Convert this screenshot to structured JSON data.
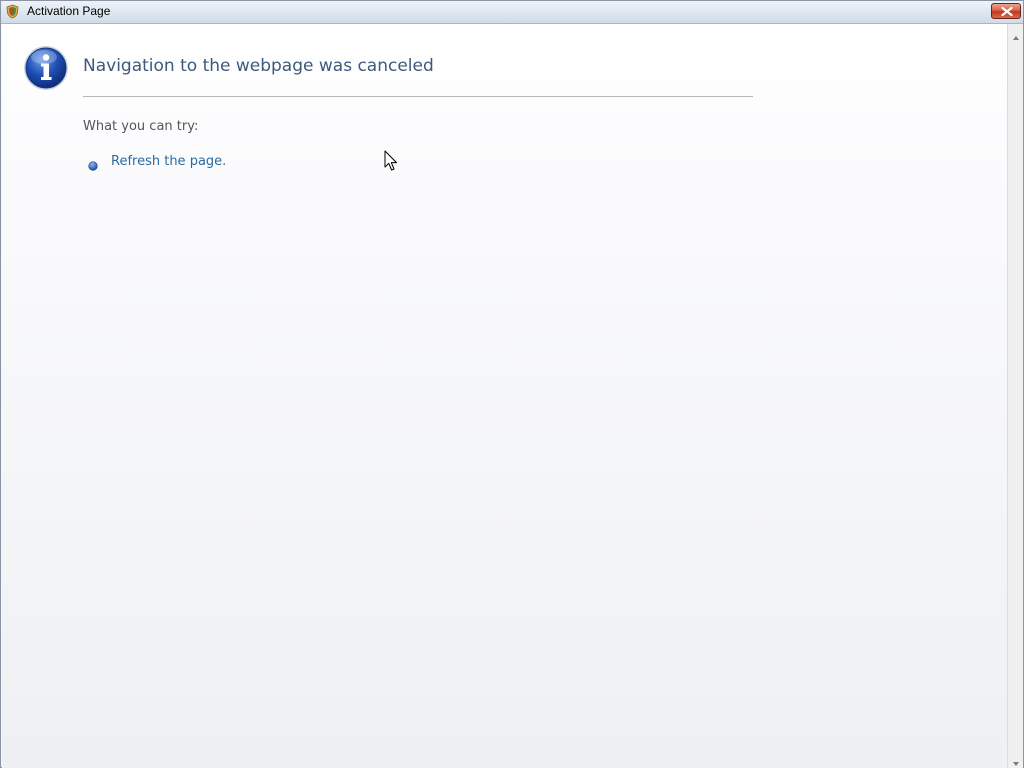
{
  "window": {
    "title": "Activation Page"
  },
  "page": {
    "heading": "Navigation to the webpage was canceled",
    "try_label": "What you can try:",
    "suggestions": [
      {
        "label": "Refresh the page.",
        "icon": "bullet-icon"
      }
    ]
  },
  "icons": {
    "app": "shield-icon",
    "info": "info-icon",
    "close": "close-icon",
    "cursor": "mouse-pointer-icon"
  },
  "colors": {
    "heading": "#3c5a7d",
    "link": "#2a6aa0",
    "close_button": "#c2381f",
    "info_icon": "#1f4fb4"
  }
}
